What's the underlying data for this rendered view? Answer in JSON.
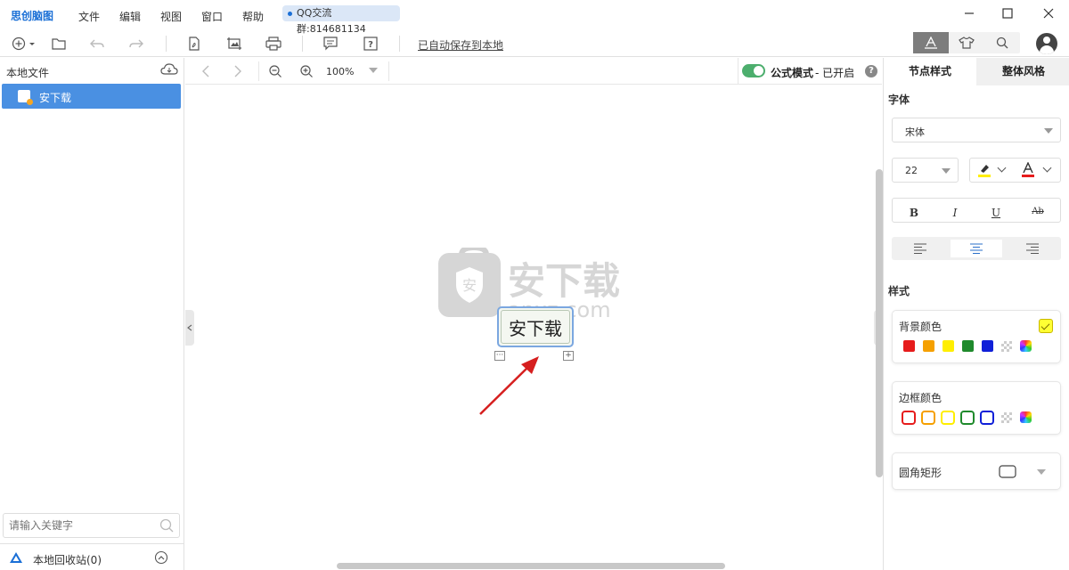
{
  "app": {
    "name": "思创脑图"
  },
  "menu": [
    "文件",
    "编辑",
    "视图",
    "窗口",
    "帮助"
  ],
  "qq_badge": "QQ交流群:814681134",
  "toolbar": {
    "autosave": "已自动保存到本地"
  },
  "left_panel": {
    "title": "本地文件",
    "file_name": "安下载",
    "search_placeholder": "请输入关键字",
    "recycle_bin": "本地回收站(0)"
  },
  "canvas_bar": {
    "zoom": "100%",
    "formula_label": "公式模式",
    "formula_state": "- 已开启"
  },
  "canvas": {
    "node_text": "安下载",
    "watermark_text": "安下载",
    "watermark_domain": "anxz.com"
  },
  "right_panel": {
    "tabs": [
      "节点样式",
      "整体风格"
    ],
    "font_section": "字体",
    "font_family": "宋体",
    "font_size": "22",
    "format_buttons": [
      "B",
      "I",
      "U",
      "Ab"
    ],
    "style_section": "样式",
    "bg_color_title": "背景颜色",
    "border_color_title": "边框颜色",
    "shape_label": "圆角矩形",
    "palette": [
      "#e61c1c",
      "#f5a000",
      "#ffee00",
      "#1f8a2c",
      "#1020d8"
    ],
    "selected_bg_color": "#ffff33"
  }
}
